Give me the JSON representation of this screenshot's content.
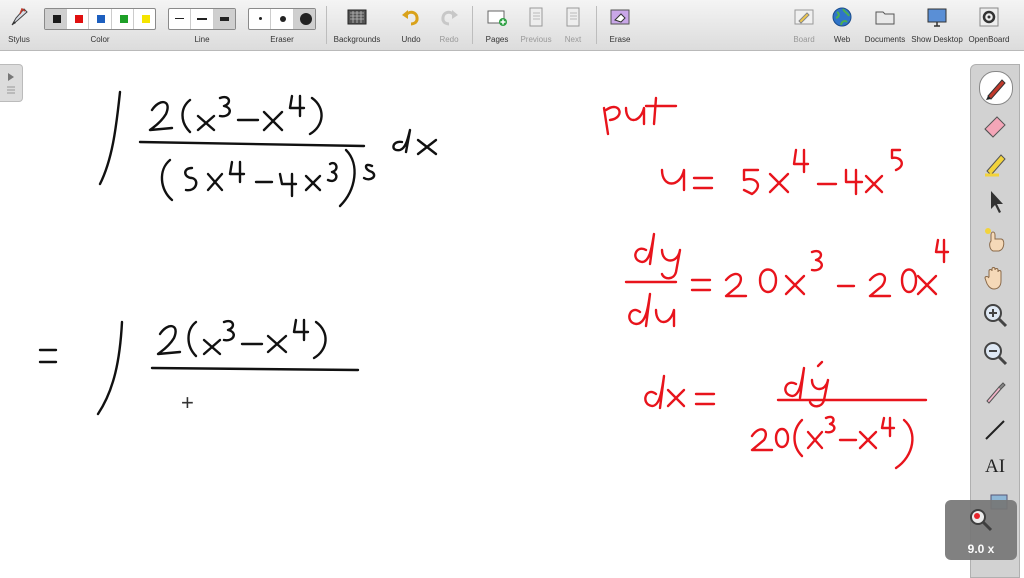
{
  "toolbar": {
    "stylus": "Stylus",
    "color": "Color",
    "line": "Line",
    "eraser": "Eraser",
    "backgrounds": "Backgrounds",
    "undo": "Undo",
    "redo": "Redo",
    "pages": "Pages",
    "previous": "Previous",
    "next": "Next",
    "erase": "Erase",
    "board": "Board",
    "web": "Web",
    "documents": "Documents",
    "show_desktop": "Show Desktop",
    "openboard": "OpenBoard"
  },
  "colors": {
    "palette": [
      "#1a1a1a",
      "#e01010",
      "#1d5fbf",
      "#1ea028",
      "#f5e400"
    ],
    "ink_black": "#111111",
    "ink_red": "#e8141c"
  },
  "icons": {
    "stylus": "stylus-icon",
    "backgrounds": "backgrounds-icon",
    "undo": "undo-arrow-icon",
    "redo": "redo-arrow-icon",
    "pages": "add-page-icon",
    "previous": "previous-page-icon",
    "next": "next-page-icon",
    "erase": "erase-page-icon",
    "board": "board-icon",
    "web": "globe-icon",
    "documents": "folder-icon",
    "show_desktop": "monitor-icon",
    "openboard": "gear-icon"
  },
  "palette_tools": [
    "pen-icon",
    "eraser-icon",
    "highlighter-icon",
    "pointer-arrow-icon",
    "laser-pointer-icon",
    "hand-icon",
    "zoom-in-icon",
    "zoom-out-icon",
    "pipette-icon",
    "line-icon",
    "text-icon",
    "capture-icon"
  ],
  "zoom": {
    "level": "9.0 x"
  },
  "canvas": {
    "text_tool_glyph": "AI",
    "cursor_glyph": "+"
  }
}
